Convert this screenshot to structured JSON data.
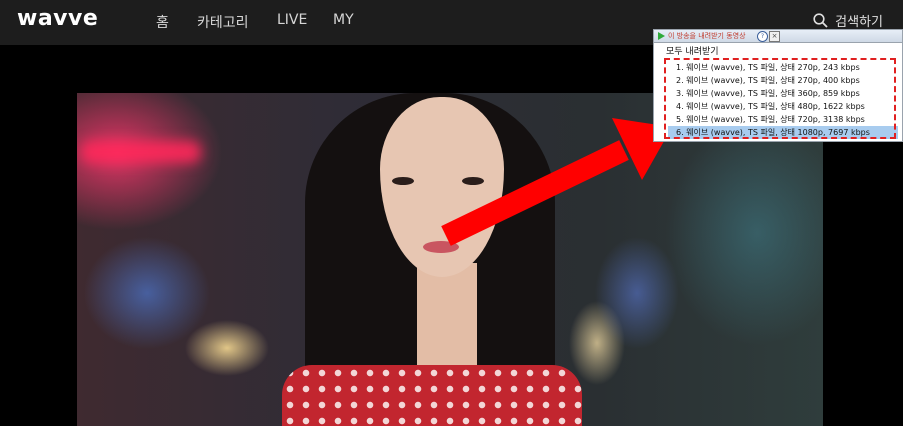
{
  "header": {
    "logo": "wavve",
    "nav": [
      "홈",
      "카테고리",
      "LIVE",
      "MY"
    ],
    "search_label": "검색하기",
    "search_icon": "search-icon"
  },
  "popup": {
    "title": "이 방송을 내려받기 동영상",
    "help_glyph": "?",
    "close_glyph": "×",
    "download_all": "모두 내려받기",
    "items": [
      "1.  웨이브 (wavve),  TS 파일, 상태 270p, 243 kbps",
      "2.  웨이브 (wavve),  TS 파일, 상태 270p, 400 kbps",
      "3.  웨이브 (wavve),  TS 파일, 상태 360p, 859 kbps",
      "4.  웨이브 (wavve),  TS 파일, 상태 480p, 1622 kbps",
      "5.  웨이브 (wavve),  TS 파일, 상태 720p, 3138 kbps",
      "6.  웨이브 (wavve),  TS 파일, 상태 1080p, 7697 kbps"
    ],
    "selected_index": 5
  },
  "colors": {
    "topbar": "#1d1d1d",
    "arrow": "#ff0000",
    "highlight": "#a8ccef",
    "dashed_border": "#e02020"
  }
}
